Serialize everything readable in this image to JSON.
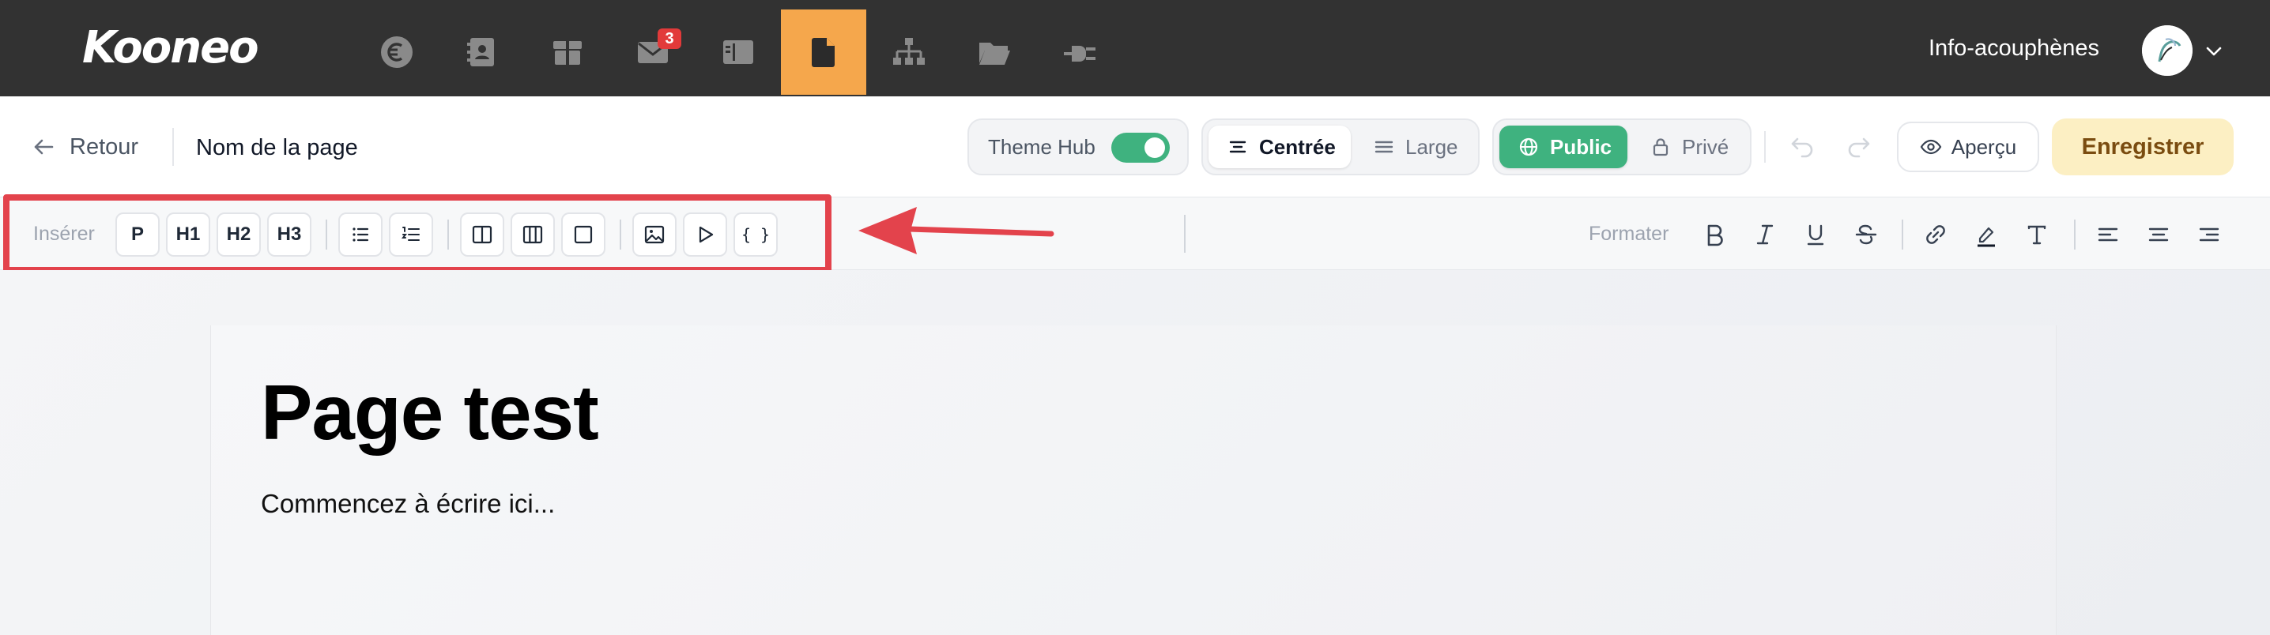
{
  "app": {
    "logo": "Kooneo",
    "nav": [
      {
        "name": "billing",
        "icon": "euro-coin-icon"
      },
      {
        "name": "contacts",
        "icon": "address-book-icon"
      },
      {
        "name": "products",
        "icon": "box-icon"
      },
      {
        "name": "emails",
        "icon": "envelope-icon",
        "badge": "3"
      },
      {
        "name": "layouts",
        "icon": "layout-icon"
      },
      {
        "name": "pages",
        "icon": "document-icon",
        "active": true
      },
      {
        "name": "funnels",
        "icon": "sitemap-icon"
      },
      {
        "name": "files",
        "icon": "folder-open-icon"
      },
      {
        "name": "integrations",
        "icon": "plug-icon"
      }
    ],
    "account": {
      "name": "Info-acouphènes"
    },
    "colors": {
      "nav_bg": "#323232",
      "active_tab": "#f5a74c",
      "badge": "#e23a3a",
      "accent_green": "#3fb27f",
      "highlight": "#e3434c"
    }
  },
  "header": {
    "back_label": "Retour",
    "page_name": "Nom de la page",
    "theme_hub": {
      "label": "Theme Hub",
      "enabled": true
    },
    "width_options": [
      {
        "label": "Centrée",
        "selected": true
      },
      {
        "label": "Large",
        "selected": false
      }
    ],
    "visibility_options": [
      {
        "label": "Public",
        "selected": true
      },
      {
        "label": "Privé",
        "selected": false
      }
    ],
    "preview_label": "Aperçu",
    "save_label": "Enregistrer"
  },
  "toolbar": {
    "insert_label": "Insérer",
    "insert_text_blocks": [
      "P",
      "H1",
      "H2",
      "H3"
    ],
    "insert_icons": [
      "bullet-list-icon",
      "numbered-list-icon",
      "two-columns-icon",
      "three-columns-icon",
      "container-box-icon",
      "image-icon",
      "video-play-icon",
      "code-braces-icon"
    ],
    "format_label": "Formater",
    "format_icons": [
      "bold-icon",
      "italic-icon",
      "underline-icon",
      "strikethrough-icon",
      "link-icon",
      "highlighter-icon",
      "text-style-icon",
      "align-left-icon",
      "align-center-icon",
      "align-right-icon"
    ],
    "code_glyph": "{ }"
  },
  "content": {
    "title": "Page test",
    "body": "Commencez à écrire ici..."
  }
}
